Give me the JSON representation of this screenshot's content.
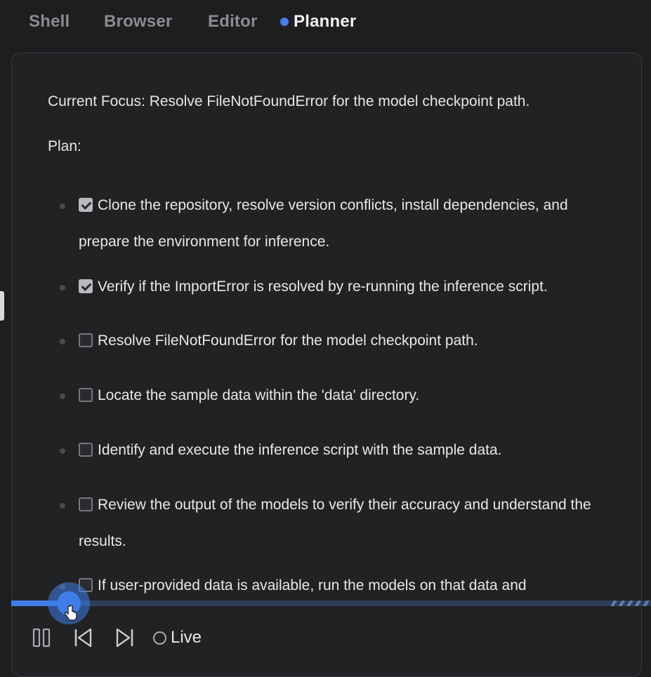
{
  "tabs": [
    {
      "label": "Shell",
      "active": false
    },
    {
      "label": "Browser",
      "active": false
    },
    {
      "label": "Editor",
      "active": false
    },
    {
      "label": "Planner",
      "active": true
    }
  ],
  "planner": {
    "focus": "Current Focus: Resolve FileNotFoundError for the model checkpoint path.",
    "plan_label": "Plan:",
    "items": [
      {
        "text": "Clone the repository, resolve version conflicts, install dependencies, and prepare the environment for inference.",
        "checked": true
      },
      {
        "text": "Verify if the ImportError is resolved by re-running the inference script.",
        "checked": true
      },
      {
        "text": "Resolve FileNotFoundError for the model checkpoint path.",
        "checked": false
      },
      {
        "text": "Locate the sample data within the 'data' directory.",
        "checked": false
      },
      {
        "text": "Identify and execute the inference script with the sample data.",
        "checked": false
      },
      {
        "text": "Review the output of the models to verify their accuracy and understand the results.",
        "checked": false
      },
      {
        "text": "If user-provided data is available, run the models on that data and",
        "checked": false
      }
    ]
  },
  "playback": {
    "progress_fraction": 0.09,
    "live_label": "Live",
    "icons": [
      "pause-icon",
      "skip-back-icon",
      "skip-forward-icon",
      "live-indicator-icon"
    ]
  },
  "colors": {
    "accent": "#3f7ee8",
    "active_dot": "#4a7cf0",
    "background": "#1d1e20",
    "panel": "#212224"
  }
}
